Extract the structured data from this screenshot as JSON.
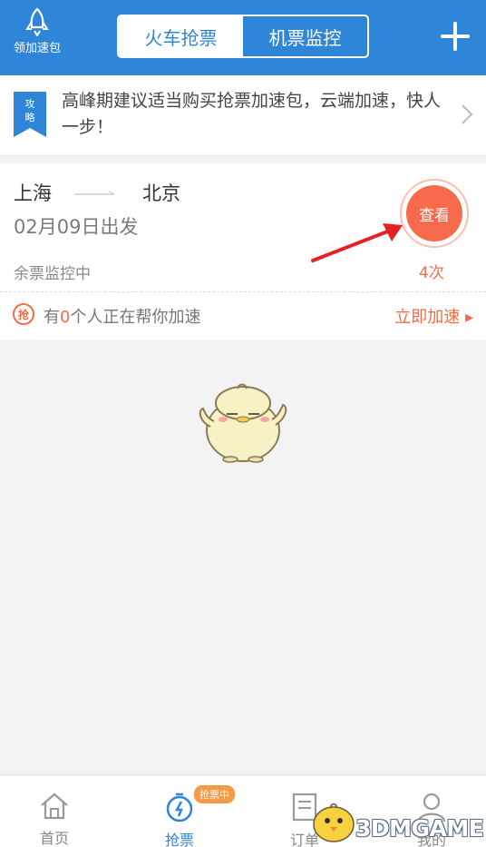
{
  "header": {
    "left_label": "领加速包",
    "tabs": [
      {
        "label": "火车抢票",
        "active": true
      },
      {
        "label": "机票监控",
        "active": false
      }
    ],
    "brand_color": "#2f86d8"
  },
  "tip": {
    "badge": "攻略",
    "text": "高峰期建议适当购买抢票加速包，云端加速，快人一步！"
  },
  "ticket": {
    "from": "上海",
    "to": "北京",
    "date": "02月09日出发",
    "status": "余票监控中",
    "view_label": "查看",
    "count": "4次"
  },
  "boost": {
    "icon_text": "抢",
    "prefix": "有",
    "count": "0",
    "suffix": "个人正在帮你加速",
    "link": "立即加速 ▸"
  },
  "tabbar": {
    "badge": "抢票中",
    "items": [
      {
        "label": "首页",
        "icon": "home-icon"
      },
      {
        "label": "抢票",
        "icon": "stopwatch-icon"
      },
      {
        "label": "订单",
        "icon": "order-icon"
      },
      {
        "label": "我的",
        "icon": "user-icon"
      }
    ]
  },
  "watermark": "3DMGAME",
  "accent_color": "#f26b43"
}
